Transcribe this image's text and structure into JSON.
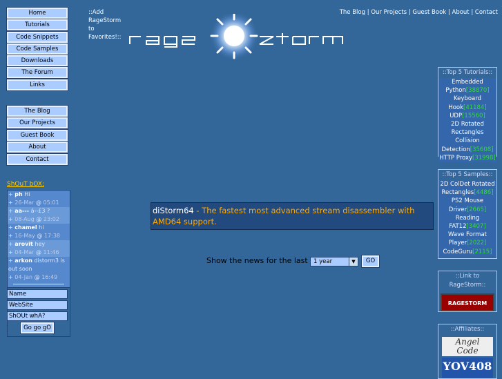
{
  "nav_primary": [
    "Home",
    "Tutorials",
    "Code Snippets",
    "Code Samples",
    "Downloads",
    "The Forum",
    "Links"
  ],
  "nav_secondary": [
    "The Blog",
    "Our Projects",
    "Guest Book",
    "About",
    "Contact"
  ],
  "favorites": [
    "::Add",
    "RageStorm",
    "to",
    "Favorites!::"
  ],
  "logo": {
    "left": "rage",
    "right": "storm"
  },
  "top_links": [
    "The Blog",
    "Our Projects",
    "Guest Book",
    "About",
    "Contact"
  ],
  "shoutbox": {
    "title": "ShOuT bOX:",
    "entries": [
      {
        "name": "ph",
        "msg": "Hi",
        "date": "26-Mar",
        "time": "05:01"
      },
      {
        "name": "aa---",
        "msg": "á--£3 ?",
        "date": "08-Aug",
        "time": "23:02"
      },
      {
        "name": "chamel",
        "msg": "hi",
        "date": "16-May",
        "time": "17:38"
      },
      {
        "name": "arovit",
        "msg": "hey",
        "date": "04-Mar",
        "time": "11:46"
      },
      {
        "name": "arkon",
        "msg": "distorm3 is out soon",
        "date": "04-Jan",
        "time": "16:49"
      }
    ],
    "at": "@",
    "name_field": "Name",
    "website_field": "WebSite",
    "shout_field": "ShOUt whA?",
    "go_button": "Go go gO"
  },
  "news": {
    "title": "diStorm64",
    "separator": " - ",
    "description": "The fastest most advanced stream disassembler with AMD64 support."
  },
  "filter": {
    "label": "Show the news for the last",
    "selected": "1 year",
    "go": "GO"
  },
  "top_tutorials": {
    "heading": "::Top 5 Tutorials::",
    "items": [
      {
        "text": "Embedded"
      },
      {
        "text": "Python",
        "count": "[38870]"
      },
      {
        "text": "Keyboard"
      },
      {
        "text": "Hook",
        "count": "[41184]"
      },
      {
        "text": "UDP",
        "count": "[15560]"
      },
      {
        "text": "2D Rotated"
      },
      {
        "text": "Rectangles Collision"
      },
      {
        "text": "Detection",
        "count": "[35608]"
      },
      {
        "text": "HTTP Proxy",
        "count": "[31998]"
      }
    ]
  },
  "top_samples": {
    "heading": "::Top 5 Samples::",
    "items": [
      {
        "text": "2D ColDet Rotated"
      },
      {
        "text": "Rectangles",
        "count": "[4486]"
      },
      {
        "text": "PS2 Mouse"
      },
      {
        "text": "Driver",
        "count": "[2665]"
      },
      {
        "text": "Reading"
      },
      {
        "text": "FAT12",
        "count": "[3407]"
      },
      {
        "text": "Wave Format"
      },
      {
        "text": "Player",
        "count": "[2022]"
      },
      {
        "text": "CodeGuru",
        "count": "[2115]"
      }
    ]
  },
  "link_box": {
    "heading": "::Link to RageStorm::",
    "badge": "RAGESTORM"
  },
  "affiliates": {
    "heading": "::Affiliates::",
    "angel_line1": "Angel",
    "angel_line2": "Code",
    "yov": "YOV408"
  }
}
